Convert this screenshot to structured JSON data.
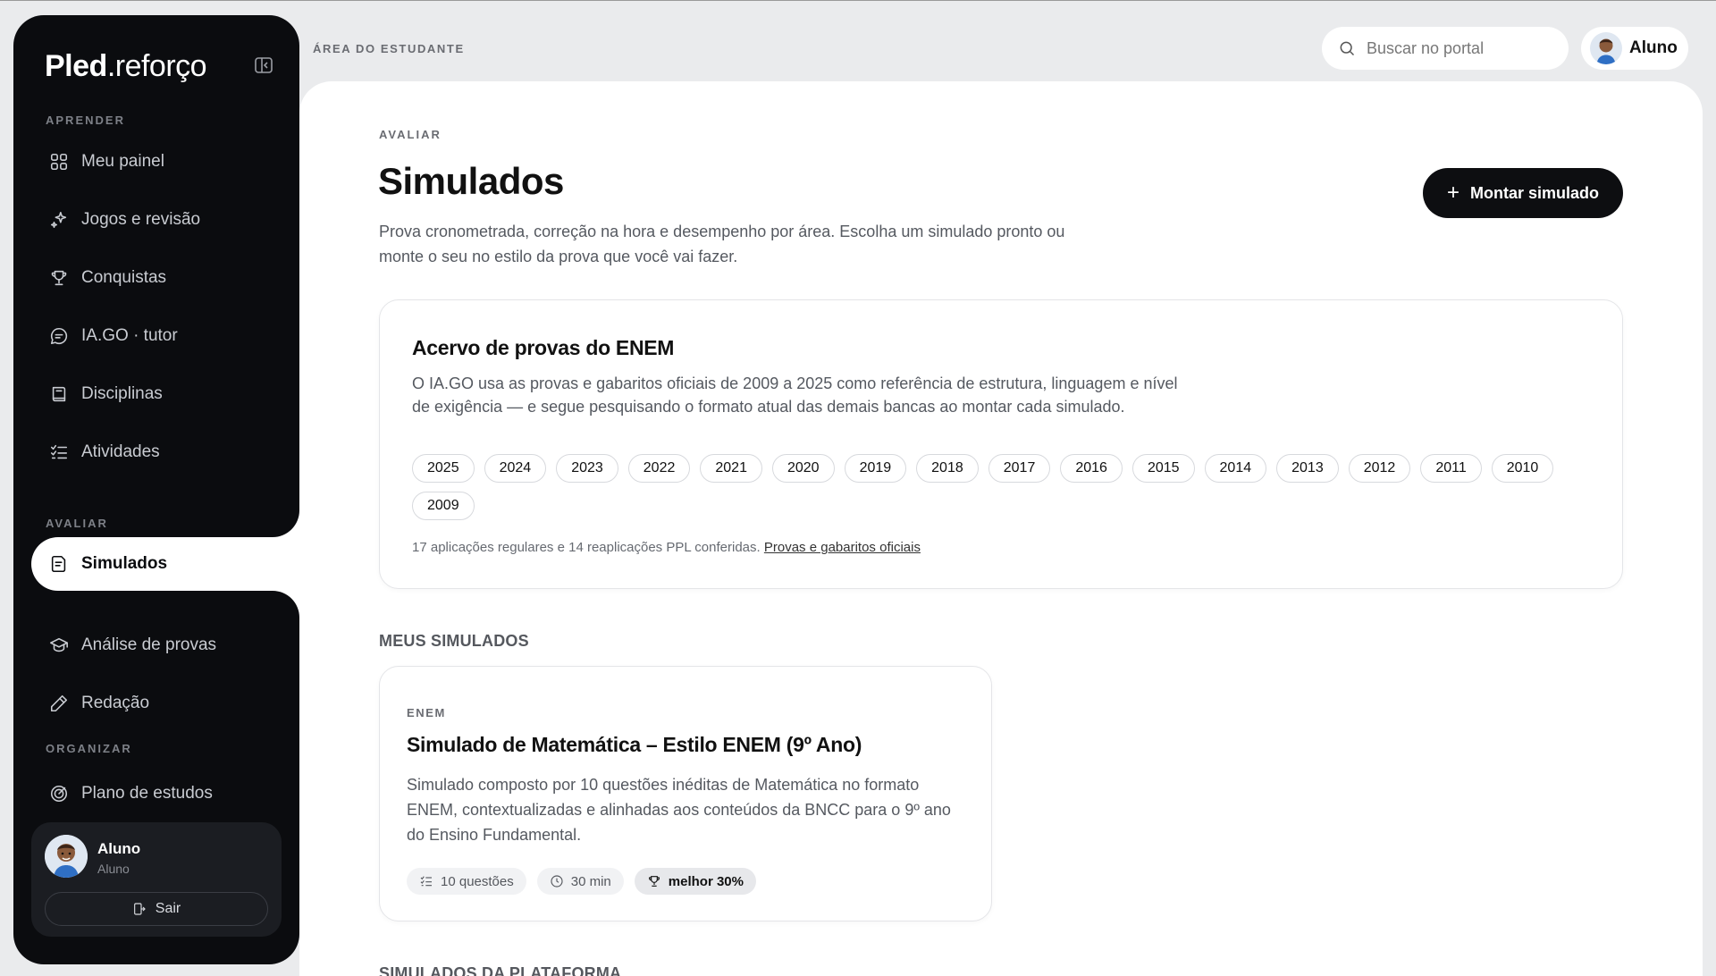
{
  "brand": {
    "bold": "Pled",
    "light": ".reforço"
  },
  "sidebar": {
    "sections": [
      "APRENDER",
      "AVALIAR",
      "ORGANIZAR"
    ],
    "items": [
      {
        "label": "Meu painel",
        "icon": "grid-icon"
      },
      {
        "label": "Jogos e revisão",
        "icon": "sparkles-icon"
      },
      {
        "label": "Conquistas",
        "icon": "trophy-icon"
      },
      {
        "label": "IA.GO · tutor",
        "icon": "chat-icon"
      },
      {
        "label": "Disciplinas",
        "icon": "book-icon"
      },
      {
        "label": "Atividades",
        "icon": "list-icon"
      },
      {
        "label": "Simulados",
        "icon": "document-icon",
        "active": true
      },
      {
        "label": "Análise de provas",
        "icon": "graduation-cap-icon"
      },
      {
        "label": "Redação",
        "icon": "pencil-icon"
      },
      {
        "label": "Plano de estudos",
        "icon": "target-icon"
      }
    ],
    "user": {
      "name": "Aluno",
      "role": "Aluno",
      "logout_label": "Sair"
    }
  },
  "header": {
    "breadcrumb": "ÁREA DO ESTUDANTE",
    "search_placeholder": "Buscar no portal",
    "profile_name": "Aluno"
  },
  "main": {
    "eyebrow": "AVALIAR",
    "title": "Simulados",
    "description": "Prova cronometrada, correção na hora e desempenho por área. Escolha um simulado pronto ou monte o seu no estilo da prova que você vai fazer.",
    "build_button": "Montar simulado",
    "acervo": {
      "title": "Acervo de provas do ENEM",
      "description": "O IA.GO usa as provas e gabaritos oficiais de 2009 a 2025 como referência de estrutura, linguagem e nível de exigência — e segue pesquisando o formato atual das demais bancas ao montar cada simulado.",
      "years": [
        "2025",
        "2024",
        "2023",
        "2022",
        "2021",
        "2020",
        "2019",
        "2018",
        "2017",
        "2016",
        "2015",
        "2014",
        "2013",
        "2012",
        "2011",
        "2010",
        "2009"
      ],
      "footnote": "17 aplicações regulares e 14 reaplicações PPL conferidas.",
      "footnote_link": "Provas e gabaritos oficiais"
    },
    "my_section_title": "MEUS SIMULADOS",
    "platform_section_title": "SIMULADOS DA PLATAFORMA",
    "my_simulados": [
      {
        "tag": "ENEM",
        "title": "Simulado de Matemática – Estilo ENEM (9º Ano)",
        "description": "Simulado composto por 10 questões inéditas de Matemática no formato ENEM, contextualizadas e alinhadas aos conteúdos da BNCC para o 9º ano do Ensino Fundamental.",
        "questions": "10 questões",
        "duration": "30 min",
        "best": "melhor 30%"
      }
    ]
  }
}
